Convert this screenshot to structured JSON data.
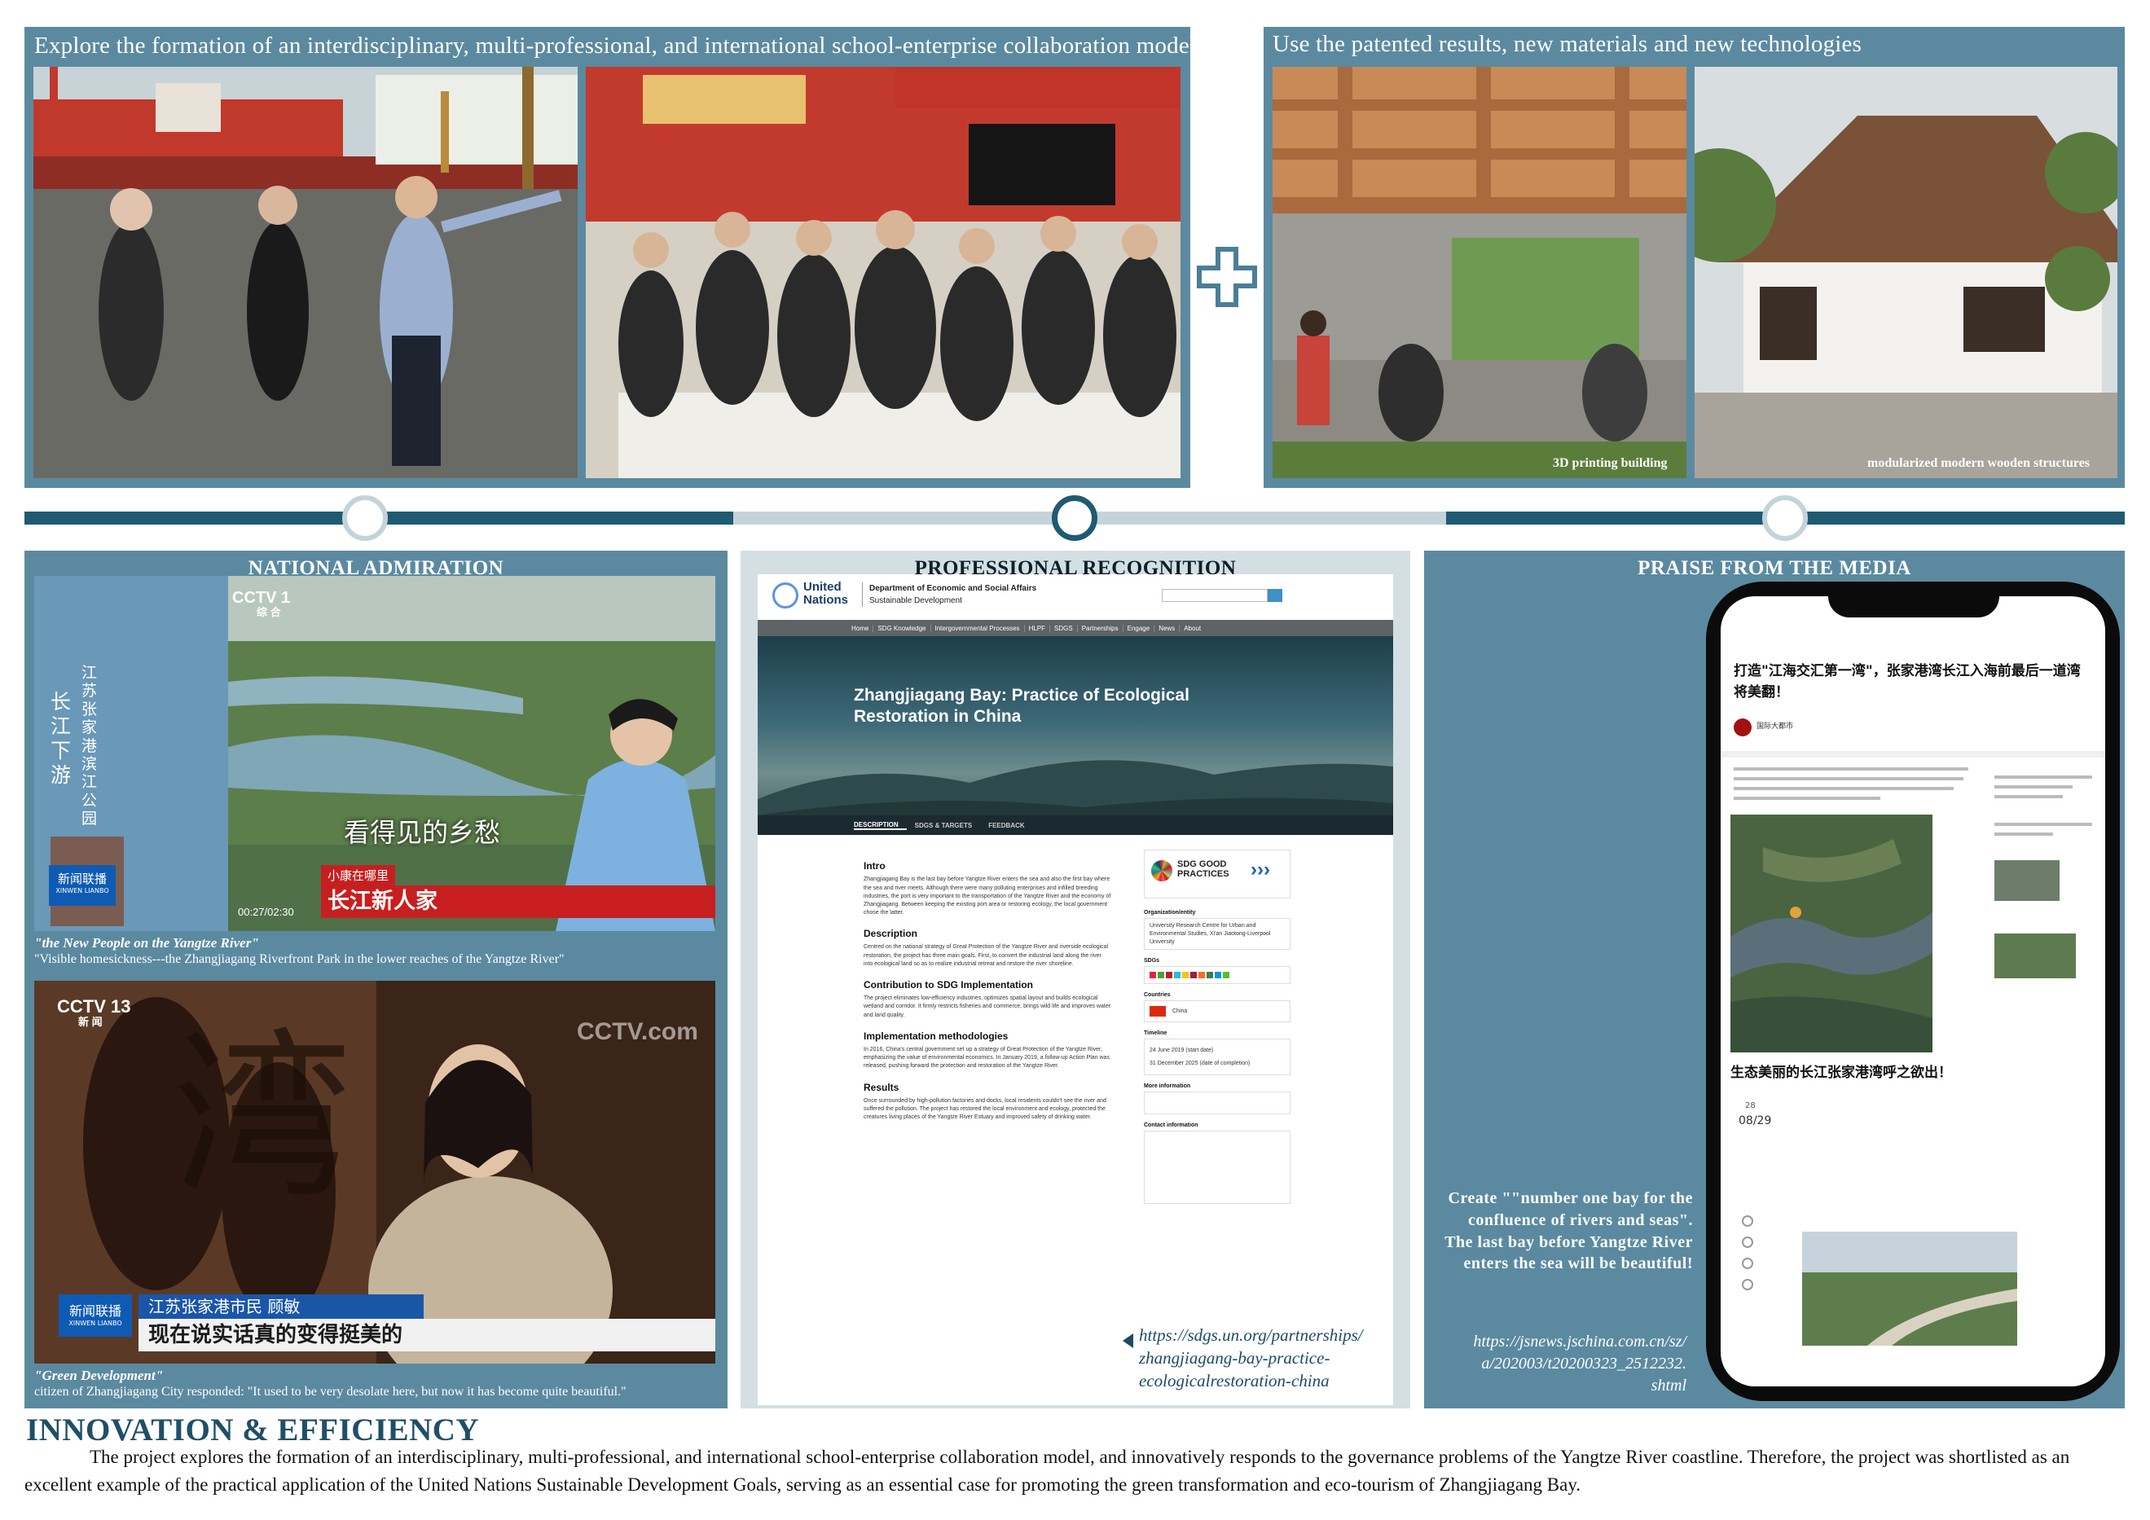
{
  "top_left": {
    "heading": "Explore the formation of an interdisciplinary, multi-professional, and international school-enterprise collaboration model"
  },
  "top_right": {
    "heading": "Use the patented results, new materials and new technologies",
    "caption_3d": "3D printing building",
    "caption_wood": "modularized modern wooden structures"
  },
  "national": {
    "title": "NATIONAL ADMIRATION",
    "tv1_channel": "CCTV 1",
    "tv1_channel_sub": "综 合",
    "tv1_vertical": "江苏张家港滨江公园",
    "tv1_vertical_big": "长江下游",
    "tv1_overlay": "看得见的乡愁",
    "tv1_program_tag": "小康在哪里",
    "tv1_program": "长江新人家",
    "tv1_news": "新闻联播",
    "tv1_news_en": "XINWEN LIANBO",
    "tv1_time": "00:27/02:30",
    "caption1_title": "\"the New People on the Yangtze River\"",
    "caption1_text": "\"Visible homesickness---the Zhangjiagang Riverfront Park in the lower reaches of the Yangtze River\"",
    "tv2_channel": "CCTV 13",
    "tv2_channel_sub": "新 闻",
    "tv2_logo": "CCTV.com",
    "tv2_calligraphy": "湾",
    "tv2_name": "江苏张家港市民 顾敏",
    "tv2_quote": "现在说实话真的变得挺美的",
    "tv2_news": "新闻联播",
    "tv2_news_en": "XINWEN LIANBO",
    "caption2_title": "\"Green Development\"",
    "caption2_text": "citizen of Zhangjiagang City responded: \"It used to be very desolate here, but now it has become quite beautiful.\""
  },
  "professional": {
    "title": "PROFESSIONAL RECOGNITION",
    "un_name_1": "United",
    "un_name_2": "Nations",
    "dept_1": "Department of Economic and Social Affairs",
    "dept_2": "Sustainable Development",
    "nav": [
      "Home",
      "SDG Knowledge",
      "Intergovernmental Processes",
      "HLPF",
      "SDGS",
      "Partnerships",
      "Engage",
      "News",
      "About"
    ],
    "hero_title": "Zhangjiagang Bay: Practice of Ecological Restoration in China",
    "tabs": [
      "DESCRIPTION",
      "SDGS & TARGETS",
      "FEEDBACK"
    ],
    "sections": [
      {
        "h": "Intro",
        "t": "Zhangjiagang Bay is the last bay before Yangtze River enters the sea and also the first bay where the sea and river meets. Although there were many polluting enterprises and infilled breeding industries, the port is very important to the transportation of the Yangtze River and the economy of Zhangjiagang. Between keeping the existing port area or restoring ecology, the local government chose the latter."
      },
      {
        "h": "Description",
        "t": "Centred on the national strategy of Great Protection of the Yangtze River and riverside ecological restoration, the project has three main goals. First, to convert the industrial land along the river into ecological land so as to realize industrial retreat and restore the river shoreline."
      },
      {
        "h": "Contribution to SDG Implementation",
        "t": "The project eliminates low-efficiency industries, optimizes spatial layout and builds ecological wetland and corridor. It firmly restricts fisheries and commerce, brings wild life and improves water and land quality."
      },
      {
        "h": "Implementation methodologies",
        "t": "In 2016, China's central government set up a strategy of Great Protection of the Yangtze River, emphasizing the value of environmental economics. In January 2019, a follow-up Action Plan was released, pushing forward the protection and restoration of the Yangtze River."
      },
      {
        "h": "Results",
        "t": "Once surrounded by high-pollution factories and docks, local residents couldn't see the river and suffered the pollution. The project has restored the local environment and ecology, protected the creatures living places of the Yangtze River Estuary and improved safety of drinking water."
      }
    ],
    "sdg_badge_1": "SDG GOOD",
    "sdg_badge_2": "PRACTICES",
    "side_labels": [
      "Organization/entity",
      "SDGs",
      "Countries",
      "Timeline",
      "More information",
      "Contact information"
    ],
    "side_org": "University Research Centre for Urban and Environmental Studies, Xi'an Jiaotong-Liverpool University",
    "side_country": "China",
    "side_time_1": "24 June 2019 (start date)",
    "side_time_2": "31 December 2025 (date of completion)",
    "link": "https://sdgs.un.org/partnerships/zhangjiagang-bay-practice-ecologicalrestoration-china",
    "link_lines": [
      "https://sdgs.un.org/partnerships/",
      "zhangjiagang-bay-practice-",
      "ecologicalrestoration-china"
    ]
  },
  "media": {
    "title": "PRAISE FROM THE MEDIA",
    "headline": "打造\"江海交汇第一湾\"，张家港湾长江入海前最后一道湾将美翻！",
    "author": "国际大都市",
    "map_caption": "生态美丽的长江张家港湾呼之欲出！",
    "date_day": "28",
    "date_mo": "08/29",
    "quote": "Create \"\"number one bay for the confluence of rivers and seas\". The last bay before Yangtze River enters the sea will be beautiful!",
    "link": "https://jsnews.jschina.com.cn/sz/a/202003/t20200323_2512232.shtml",
    "link_lines": [
      "https://jsnews.jschina.com.cn/sz/",
      "a/202003/t20200323_2512232.",
      "shtml"
    ]
  },
  "footer": {
    "title": "INNOVATION & EFFICIENCY",
    "body": "The project explores the formation of an interdisciplinary, multi-professional, and international school-enterprise collaboration model, and innovatively responds to the governance problems of the Yangtze River coastline. Therefore, the project was shortlisted as an excellent example of the practical application of the United Nations Sustainable Development Goals, serving as an essential case for promoting the green transformation and eco-tourism of Zhangjiagang Bay."
  },
  "colors": {
    "panel_teal": "#5b8aa0",
    "timeline_dark": "#1f5a73",
    "timeline_light": "#c4d3da",
    "plus": "#4a7f96"
  }
}
